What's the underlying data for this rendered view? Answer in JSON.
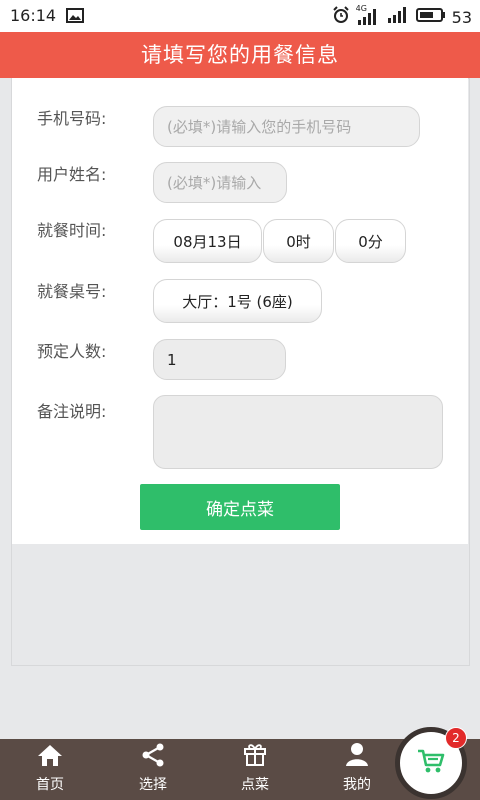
{
  "status": {
    "time": "16:14",
    "network": "4G",
    "battery": "53"
  },
  "header": {
    "title": "请填写您的用餐信息"
  },
  "form": {
    "phone_label": "手机号码:",
    "phone_placeholder": "(必填*)请输入您的手机号码",
    "name_label": "用户姓名:",
    "name_placeholder": "(必填*)请输入",
    "time_label": "就餐时间:",
    "date_value": "08月13日",
    "hour_value": "0时",
    "minute_value": "0分",
    "table_label": "就餐桌号:",
    "table_value": "大厅：1号 (6座)",
    "people_label": "预定人数:",
    "people_value": "1",
    "note_label": "备注说明:",
    "note_value": "",
    "confirm_label": "确定点菜"
  },
  "tabs": [
    {
      "label": "首页",
      "icon": "home-icon"
    },
    {
      "label": "选择",
      "icon": "share-icon"
    },
    {
      "label": "点菜",
      "icon": "gift-icon"
    },
    {
      "label": "我的",
      "icon": "user-icon"
    }
  ],
  "cart": {
    "badge": "2",
    "icon": "cart-icon"
  },
  "colors": {
    "header": "#ee5a4a",
    "confirm": "#2fbe6a",
    "tabbar": "#5a4b45",
    "badge": "#e22a2a"
  }
}
